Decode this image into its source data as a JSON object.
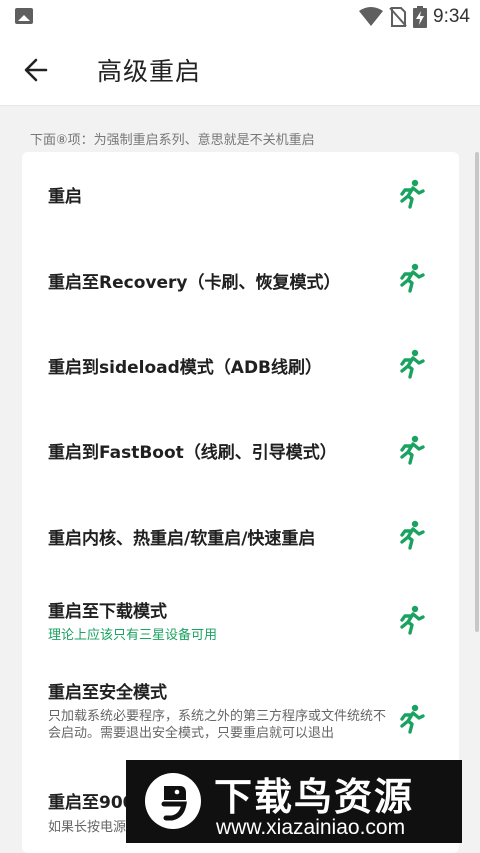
{
  "status_bar": {
    "time": "9:34"
  },
  "app_bar": {
    "title": "高级重启"
  },
  "hint": "下面⑧项：为强制重启系列、意思就是不关机重启",
  "accent_color": "#1aa260",
  "items": [
    {
      "label": "重启"
    },
    {
      "label": "重启至Recovery（卡刷、恢复模式）"
    },
    {
      "label": "重启到sideload模式（ADB线刷）"
    },
    {
      "label": "重启到FastBoot（线刷、引导模式）"
    },
    {
      "label": "重启内核、热重启/软重启/快速重启"
    },
    {
      "label": "重启至下载模式",
      "note": "理论上应该只有三星设备可用"
    },
    {
      "label": "重启至安全模式",
      "note": "只加载系统必要程序，系统之外的第三方程序或文件统统不会启动。需要退出安全模式，只要重启就可以退出"
    },
    {
      "label": "重启至9008",
      "note": "如果长按电源…"
    }
  ],
  "watermark": {
    "title": "下载鸟资源",
    "url": "www.xiazainiao.com"
  },
  "icons": [
    "gallery-icon",
    "wifi-icon",
    "no-sim-icon",
    "battery-charging-icon",
    "back-arrow-icon",
    "running-man-icon"
  ]
}
